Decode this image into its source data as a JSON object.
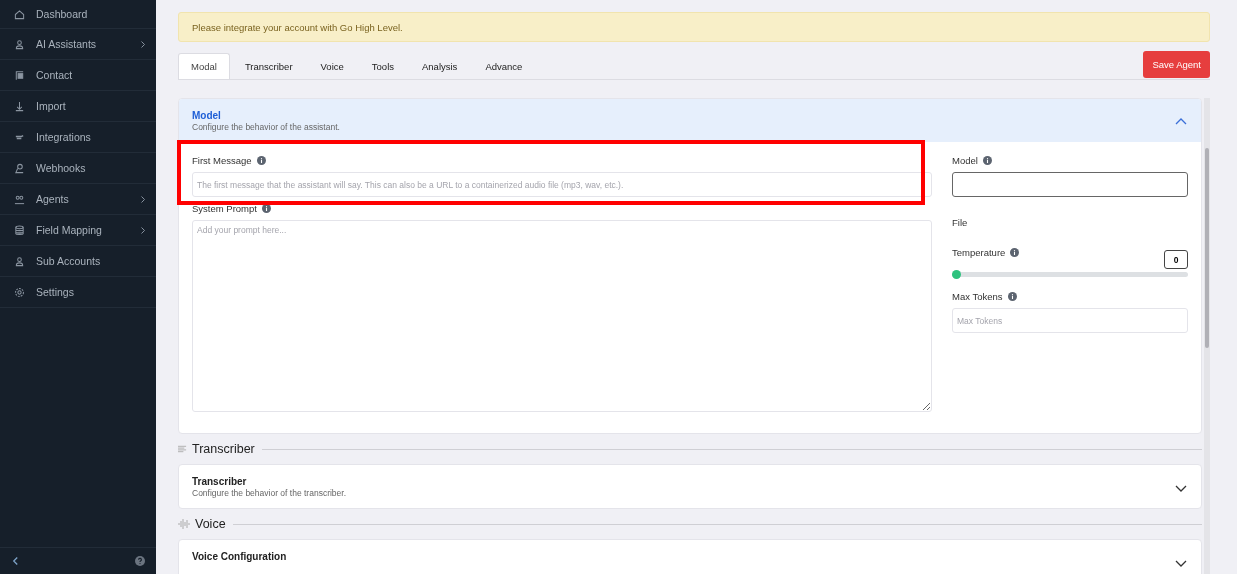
{
  "sidebar": {
    "items": [
      {
        "label": "Dashboard",
        "has_submenu": false
      },
      {
        "label": "AI Assistants",
        "has_submenu": true
      },
      {
        "label": "Contact",
        "has_submenu": false
      },
      {
        "label": "Import",
        "has_submenu": false
      },
      {
        "label": "Integrations",
        "has_submenu": false
      },
      {
        "label": "Webhooks",
        "has_submenu": false
      },
      {
        "label": "Agents",
        "has_submenu": true
      },
      {
        "label": "Field Mapping",
        "has_submenu": true
      },
      {
        "label": "Sub Accounts",
        "has_submenu": false
      },
      {
        "label": "Settings",
        "has_submenu": false
      }
    ]
  },
  "notice": "Please integrate your account with Go High Level.",
  "tabs": [
    {
      "label": "Modal",
      "selected": true
    },
    {
      "label": "Transcriber",
      "selected": false
    },
    {
      "label": "Voice",
      "selected": false
    },
    {
      "label": "Tools",
      "selected": false
    },
    {
      "label": "Analysis",
      "selected": false
    },
    {
      "label": "Advance",
      "selected": false
    }
  ],
  "save_button": "Save Agent",
  "model_panel": {
    "title": "Model",
    "subtitle": "Configure the behavior of the assistant.",
    "expanded": true,
    "first_message": {
      "label": "First Message",
      "placeholder": "The first message that the assistant will say. This can also be a URL to a containerized audio file (mp3, wav, etc.)."
    },
    "system_prompt": {
      "label": "System Prompt",
      "placeholder": "Add your prompt here..."
    },
    "model": {
      "label": "Model"
    },
    "file_label": "File",
    "temperature": {
      "label": "Temperature",
      "value": "0",
      "level": 0
    },
    "max_tokens": {
      "label": "Max Tokens",
      "placeholder": "Max Tokens"
    }
  },
  "sections": [
    {
      "heading": "Transcriber",
      "panel": {
        "title": "Transcriber",
        "subtitle": "Configure the behavior of the transcriber.",
        "expanded": false
      }
    },
    {
      "heading": "Voice",
      "panel": {
        "title": "Voice Configuration",
        "expanded": false
      }
    }
  ]
}
